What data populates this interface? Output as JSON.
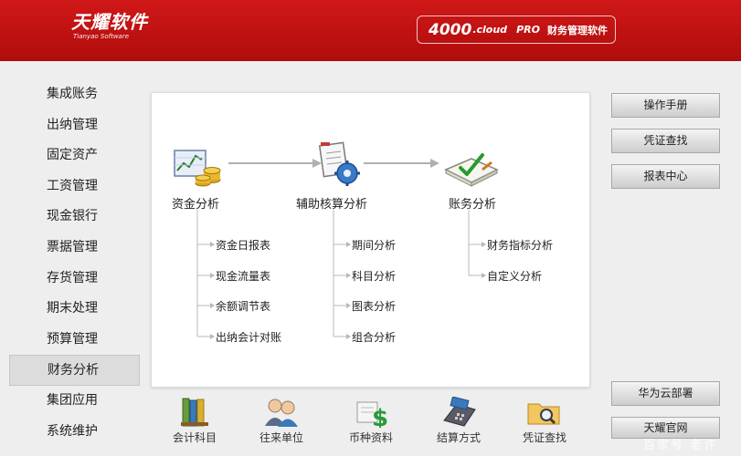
{
  "header": {
    "logo_text": "天耀软件",
    "logo_sub": "Tianyao Software",
    "product_code": "4000",
    "product_suffix": ".cloud",
    "product_pro": "PRO",
    "product_name": "财务管理软件"
  },
  "sidebar": {
    "items": [
      {
        "label": "集成账务"
      },
      {
        "label": "出纳管理"
      },
      {
        "label": "固定资产"
      },
      {
        "label": "工资管理"
      },
      {
        "label": "现金银行"
      },
      {
        "label": "票据管理"
      },
      {
        "label": "存货管理"
      },
      {
        "label": "期末处理"
      },
      {
        "label": "预算管理"
      },
      {
        "label": "财务分析",
        "active": true
      },
      {
        "label": "集团应用"
      },
      {
        "label": "系统维护"
      }
    ]
  },
  "flow": {
    "nodes": [
      {
        "label": "资金分析",
        "icon": "money-chart-icon",
        "subs": [
          "资金日报表",
          "现金流量表",
          "余额调节表",
          "出纳会计对账"
        ]
      },
      {
        "label": "辅助核算分析",
        "icon": "gear-document-icon",
        "subs": [
          "期间分析",
          "科目分析",
          "图表分析",
          "组合分析"
        ]
      },
      {
        "label": "账务分析",
        "icon": "ledger-check-icon",
        "subs": [
          "财务指标分析",
          "自定义分析"
        ]
      }
    ]
  },
  "right_buttons": {
    "manual": "操作手册",
    "voucher_query": "凭证查找",
    "report_center": "报表中心",
    "huawei_cloud": "华为云部署",
    "official_site": "天耀官网"
  },
  "bottom_bar": {
    "items": [
      {
        "label": "会计科目",
        "icon": "account-books-icon"
      },
      {
        "label": "往来单位",
        "icon": "contacts-icon"
      },
      {
        "label": "币种资料",
        "icon": "currency-icon"
      },
      {
        "label": "结算方式",
        "icon": "card-terminal-icon"
      },
      {
        "label": "凭证查找",
        "icon": "folder-search-icon"
      }
    ]
  },
  "watermark": "百家号 老许"
}
